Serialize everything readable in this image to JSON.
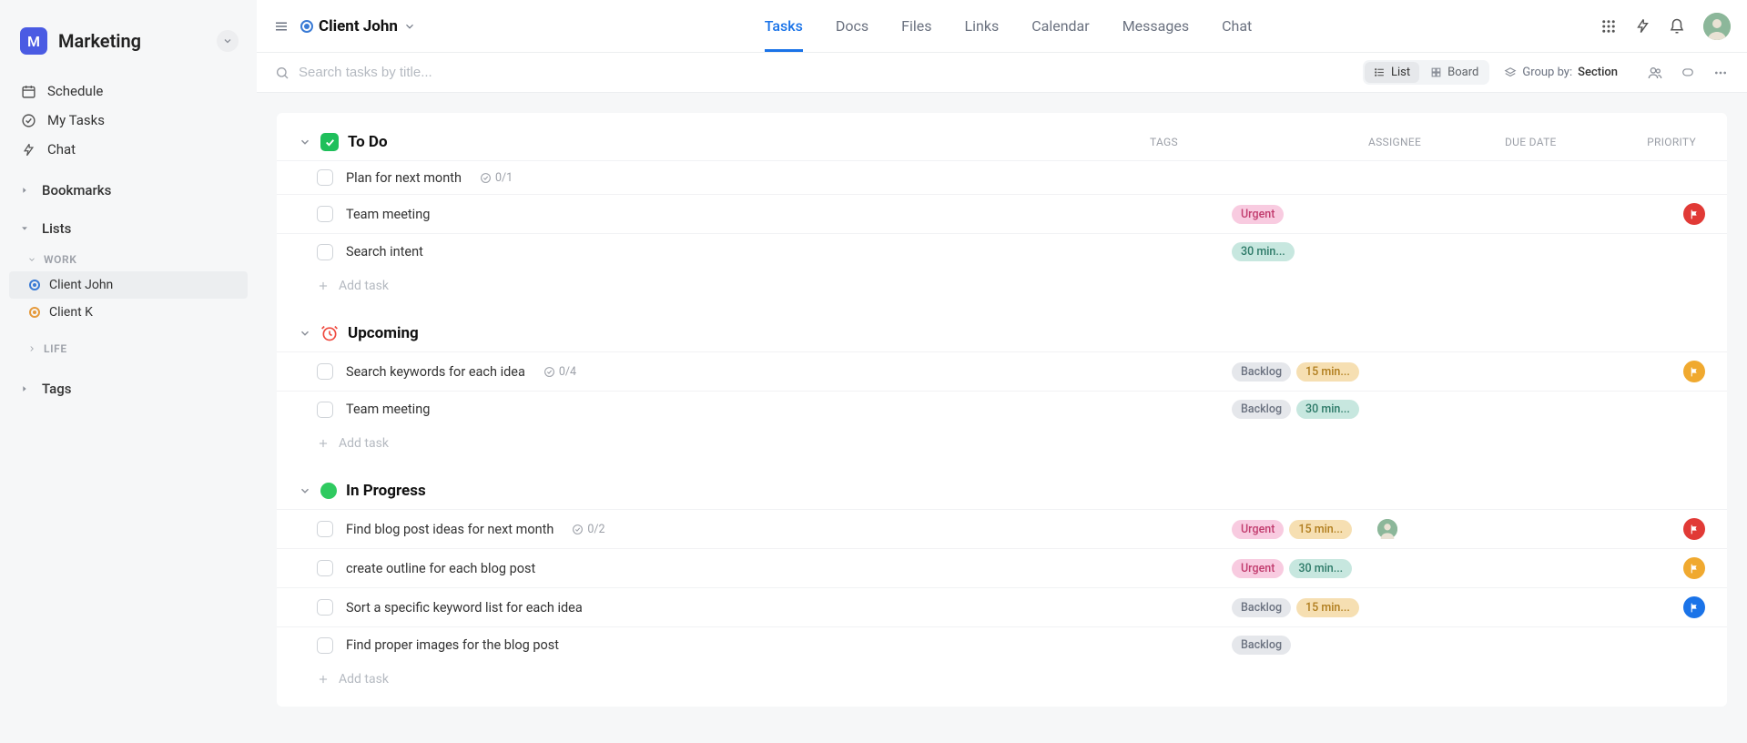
{
  "workspace": {
    "logo_letter": "M",
    "name": "Marketing"
  },
  "side_nav": {
    "schedule": "Schedule",
    "my_tasks": "My Tasks",
    "chat": "Chat",
    "bookmarks": "Bookmarks",
    "lists": "Lists",
    "tags": "Tags",
    "groups": {
      "work": "WORK",
      "life": "LIFE"
    },
    "lists_items": [
      {
        "label": "Client John",
        "active": true
      },
      {
        "label": "Client K",
        "active": false
      }
    ]
  },
  "header": {
    "title": "Client John",
    "tabs": [
      "Tasks",
      "Docs",
      "Files",
      "Links",
      "Calendar",
      "Messages",
      "Chat"
    ],
    "active_tab": "Tasks"
  },
  "toolbar": {
    "search_placeholder": "Search tasks by title...",
    "view_list": "List",
    "view_board": "Board",
    "groupby_label": "Group by:",
    "groupby_value": "Section"
  },
  "columns": {
    "tags": "TAGS",
    "assignee": "ASSIGNEE",
    "due": "DUE DATE",
    "priority": "PRIORITY"
  },
  "sections": [
    {
      "id": "todo",
      "title": "To Do",
      "icon": "green-check",
      "show_columns": true,
      "tasks": [
        {
          "title": "Plan for next month",
          "subcount": "0/1",
          "tags": [],
          "assignee": false,
          "priority": null
        },
        {
          "title": "Team meeting",
          "subcount": null,
          "tags": [
            {
              "text": "Urgent",
              "cls": "urgent"
            }
          ],
          "assignee": false,
          "priority": "red"
        },
        {
          "title": "Search intent",
          "subcount": null,
          "tags": [
            {
              "text": "30 min...",
              "cls": "t30"
            }
          ],
          "assignee": false,
          "priority": null
        }
      ]
    },
    {
      "id": "upcoming",
      "title": "Upcoming",
      "icon": "alarm",
      "show_columns": false,
      "tasks": [
        {
          "title": "Search keywords for each idea",
          "subcount": "0/4",
          "tags": [
            {
              "text": "Backlog",
              "cls": "backlog"
            },
            {
              "text": "15 min...",
              "cls": "t15"
            }
          ],
          "assignee": false,
          "priority": "orange"
        },
        {
          "title": "Team meeting",
          "subcount": null,
          "tags": [
            {
              "text": "Backlog",
              "cls": "backlog"
            },
            {
              "text": "30 min...",
              "cls": "t30"
            }
          ],
          "assignee": false,
          "priority": null
        }
      ]
    },
    {
      "id": "inprogress",
      "title": "In Progress",
      "icon": "circle-green",
      "show_columns": false,
      "tasks": [
        {
          "title": "Find blog post ideas for next month",
          "subcount": "0/2",
          "tags": [
            {
              "text": "Urgent",
              "cls": "urgent"
            },
            {
              "text": "15 min...",
              "cls": "t15"
            }
          ],
          "assignee": true,
          "priority": "red"
        },
        {
          "title": "create outline for each blog post",
          "subcount": null,
          "tags": [
            {
              "text": "Urgent",
              "cls": "urgent"
            },
            {
              "text": "30 min...",
              "cls": "t30"
            }
          ],
          "assignee": false,
          "priority": "orange"
        },
        {
          "title": "Sort a specific keyword list for each idea",
          "subcount": null,
          "tags": [
            {
              "text": "Backlog",
              "cls": "backlog"
            },
            {
              "text": "15 min...",
              "cls": "t15"
            }
          ],
          "assignee": false,
          "priority": "blue"
        },
        {
          "title": "Find proper images for the blog post",
          "subcount": null,
          "tags": [
            {
              "text": "Backlog",
              "cls": "backlog"
            }
          ],
          "assignee": false,
          "priority": null
        }
      ]
    }
  ],
  "add_task_label": "Add task"
}
